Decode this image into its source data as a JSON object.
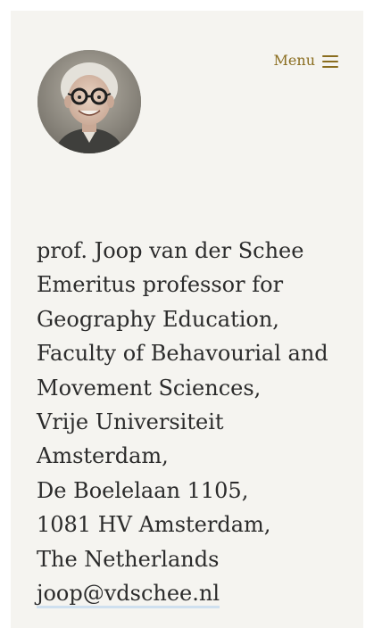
{
  "profile": {
    "avatar_icon": "portrait-photo"
  },
  "header": {
    "menu_label": "Menu",
    "menu_icon": "hamburger-icon",
    "accent_color": "#8a6d1f"
  },
  "contact": {
    "name_line": "prof. Joop van der Schee",
    "title_lines": [
      "Emeritus professor for",
      "Geography Education,",
      "Faculty of Behavourial and",
      "Movement Sciences,",
      "Vrije Universiteit",
      "Amsterdam,"
    ],
    "street": "De Boelelaan 1105,",
    "city": "1081 HV Amsterdam,",
    "country": "The Netherlands",
    "email": "joop@vdschee.nl"
  }
}
